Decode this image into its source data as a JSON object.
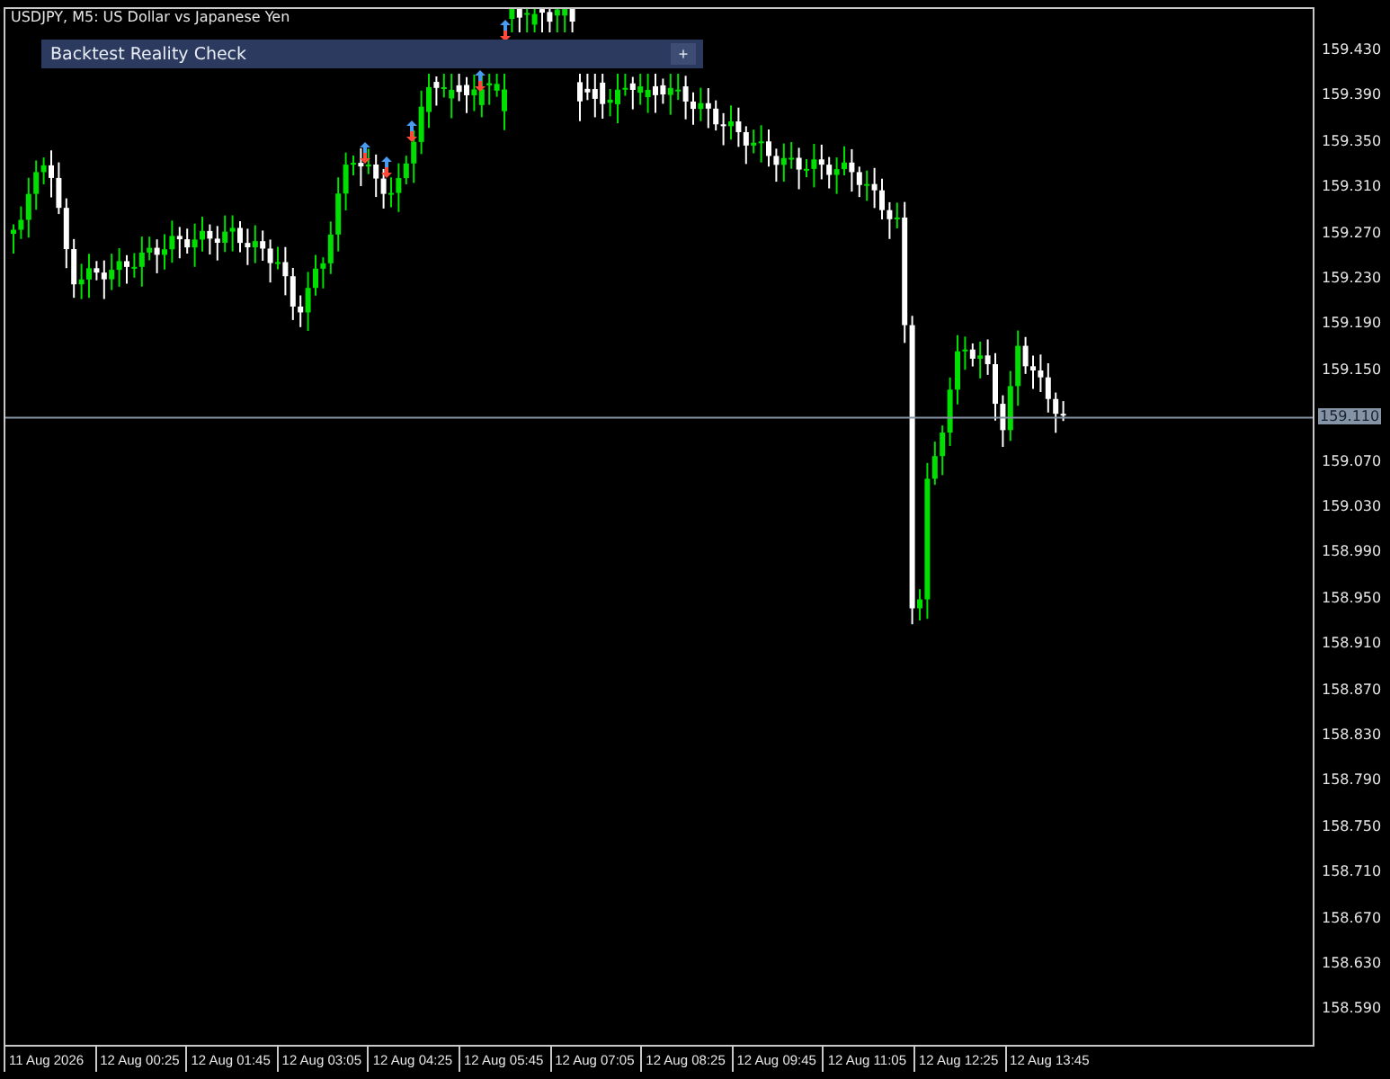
{
  "chart_title": "USDJPY, M5:  US Dollar vs Japanese Yen",
  "panel": {
    "title": "Backtest Reality Check",
    "button": "+"
  },
  "price_axis": [
    "159.430",
    "159.390",
    "159.350",
    "159.310",
    "159.270",
    "159.230",
    "159.190",
    "159.150",
    "159.070",
    "159.030",
    "158.990",
    "158.950",
    "158.910",
    "158.870",
    "158.830",
    "158.790",
    "158.750",
    "158.710",
    "158.670",
    "158.630",
    "158.590"
  ],
  "current_price": "159.110",
  "time_axis": [
    "11 Aug 2026",
    "12 Aug 00:25",
    "12 Aug 01:45",
    "12 Aug 03:05",
    "12 Aug 04:25",
    "12 Aug 05:45",
    "12 Aug 07:05",
    "12 Aug 08:25",
    "12 Aug 09:45",
    "12 Aug 11:05",
    "12 Aug 12:25",
    "12 Aug 13:45"
  ]
}
